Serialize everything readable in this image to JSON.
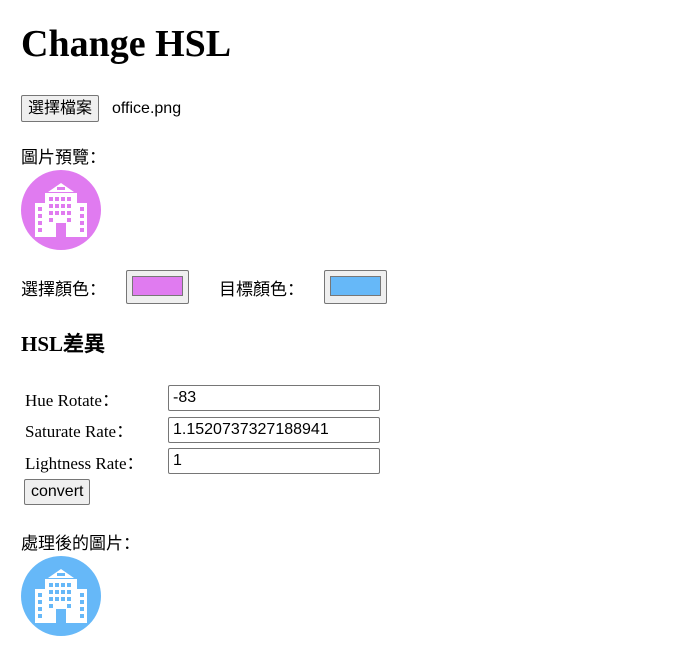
{
  "page": {
    "title": "Change HSL"
  },
  "file": {
    "button_label": "選擇檔案",
    "file_name": "office.png"
  },
  "preview": {
    "label": "圖片預覽：",
    "icon": "office-building-icon",
    "color": "#e07bf0"
  },
  "colors": {
    "source_label": "選擇顏色：",
    "source_color": "#e07bf0",
    "target_label": "目標顏色：",
    "target_color": "#66b8f8"
  },
  "hsl": {
    "heading": "HSL差異",
    "hue_label": "Hue Rotate",
    "hue_value": "-83",
    "saturate_label": "Saturate Rate",
    "saturate_value": "1.1520737327188941",
    "lightness_label": "Lightness Rate",
    "lightness_value": "1",
    "colon": "：",
    "convert_label": "convert"
  },
  "result": {
    "label": "處理後的圖片：",
    "icon": "office-building-icon",
    "color": "#66b8f8"
  }
}
